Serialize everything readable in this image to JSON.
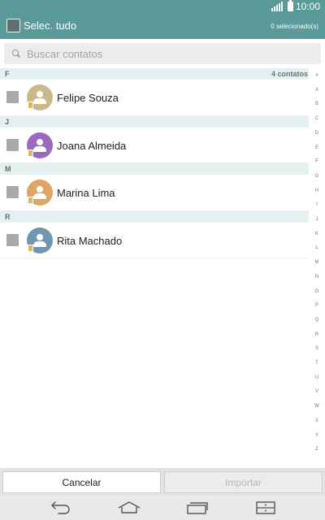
{
  "status_bar": {
    "time": "10:00"
  },
  "action_bar": {
    "select_all_label": "Selec. tudo",
    "selected_count": "0 selecionado(s)"
  },
  "search": {
    "placeholder": "Buscar contatos",
    "value": ""
  },
  "list": {
    "total_label": "4 contatos",
    "sections": [
      {
        "letter": "F",
        "contacts": [
          {
            "name": "Felipe Souza",
            "avatar_color": "#c9b98a",
            "checked": false
          }
        ]
      },
      {
        "letter": "J",
        "contacts": [
          {
            "name": "Joana Almeida",
            "avatar_color": "#9a68bf",
            "checked": false
          }
        ]
      },
      {
        "letter": "M",
        "contacts": [
          {
            "name": "Marina Lima",
            "avatar_color": "#e0a466",
            "checked": false
          }
        ]
      },
      {
        "letter": "R",
        "contacts": [
          {
            "name": "Rita Machado",
            "avatar_color": "#6f98b0",
            "checked": false
          }
        ]
      }
    ]
  },
  "index_bar": {
    "letters": [
      "#",
      "A",
      "B",
      "C",
      "D",
      "E",
      "F",
      "G",
      "H",
      "I",
      "J",
      "K",
      "L",
      "M",
      "N",
      "O",
      "P",
      "Q",
      "R",
      "S",
      "T",
      "U",
      "V",
      "W",
      "X",
      "Y",
      "Z"
    ]
  },
  "buttons": {
    "cancel": "Cancelar",
    "import": "Importar"
  },
  "nav_bar": {
    "icons": [
      "back-icon",
      "home-icon",
      "recent-apps-icon",
      "menu-icon"
    ]
  },
  "colors": {
    "header": "#5a9a98",
    "section_bg": "#e4eff0",
    "sim_badge": "#e6b64a"
  }
}
